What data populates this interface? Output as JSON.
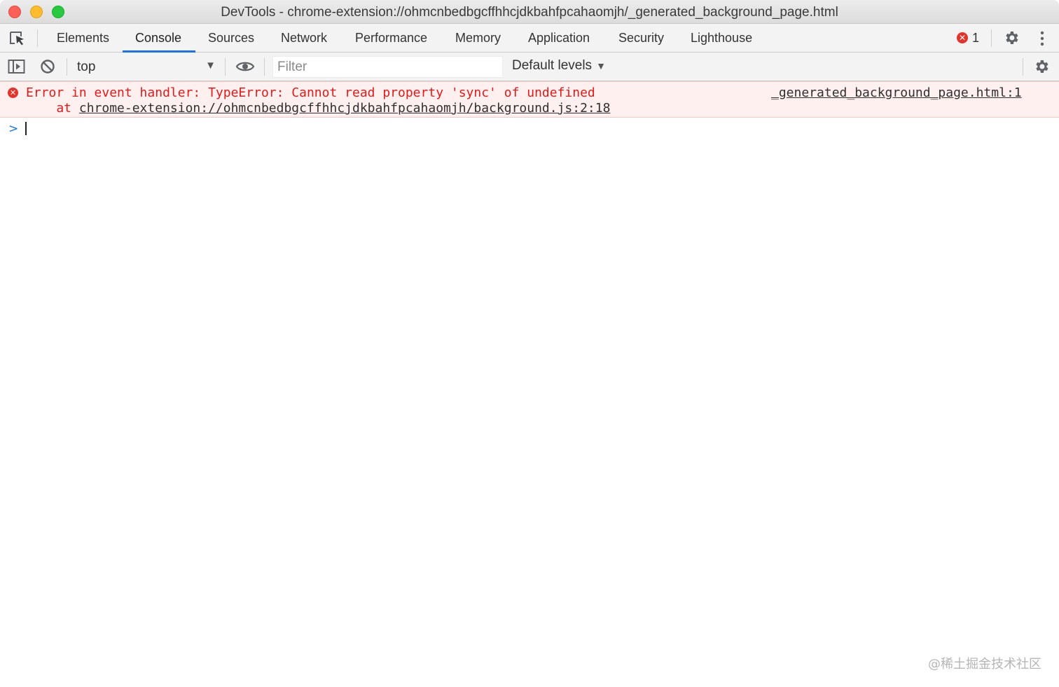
{
  "window": {
    "title": "DevTools - chrome-extension://ohmcnbedbgcffhhcjdkbahfpcahaomjh/_generated_background_page.html"
  },
  "tabs": [
    {
      "label": "Elements"
    },
    {
      "label": "Console",
      "active": true
    },
    {
      "label": "Sources"
    },
    {
      "label": "Network"
    },
    {
      "label": "Performance"
    },
    {
      "label": "Memory"
    },
    {
      "label": "Application"
    },
    {
      "label": "Security"
    },
    {
      "label": "Lighthouse"
    }
  ],
  "status": {
    "error_count": "1"
  },
  "toolbar": {
    "context": "top",
    "filter_placeholder": "Filter",
    "levels_label": "Default levels"
  },
  "messages": [
    {
      "level": "error",
      "text": "Error in event handler: TypeError: Cannot read property 'sync' of undefined",
      "stack_prefix": "    at ",
      "stack_link": "chrome-extension://ohmcnbedbgcffhhcjdkbahfpcahaomjh/background.js:2:18",
      "source": "_generated_background_page.html:1"
    }
  ],
  "prompt_symbol": ">",
  "watermark": "@稀土掘金技术社区",
  "colors": {
    "accent": "#1a73e8",
    "error_text": "#e21a1a",
    "error_bg": "#fef0ef",
    "error_icon": "#e5332a"
  },
  "icons": {
    "inspect": "inspect-element-icon",
    "sidebar": "show-sidebar-icon",
    "clear": "clear-console-icon",
    "live_expression": "eye-icon",
    "settings": "gear-icon",
    "more": "kebab-menu-icon",
    "error": "error-icon"
  }
}
